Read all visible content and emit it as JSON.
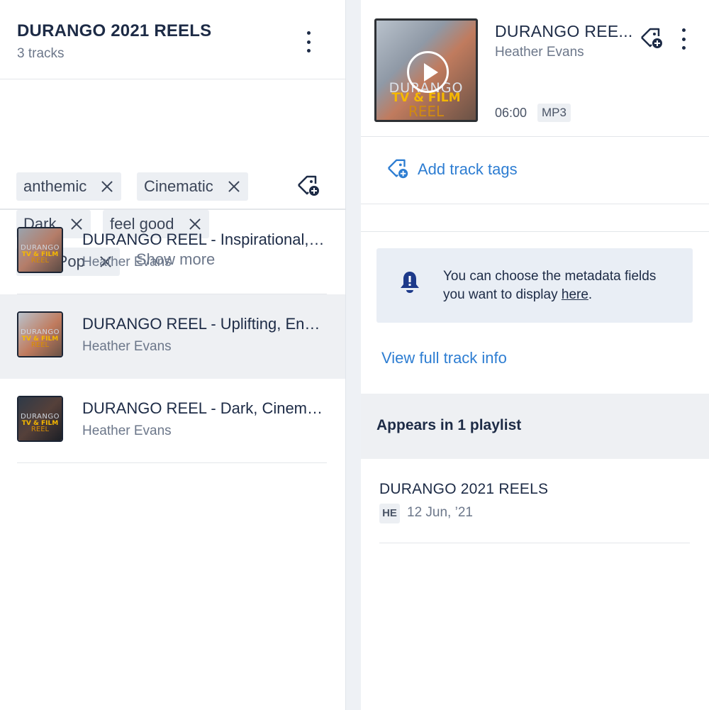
{
  "playlist": {
    "title": "DURANGO 2021 REELS",
    "track_count": "3 tracks",
    "tags": [
      "anthemic",
      "Cinematic",
      "Dark",
      "feel good",
      "Folk/Pop"
    ],
    "show_more": "Show more",
    "tracks": [
      {
        "title": "DURANGO REEL - Inspirational, Anthemic",
        "artist": "Heather Evans",
        "selected": false
      },
      {
        "title": "DURANGO REEL - Uplifting, Energetic",
        "artist": "Heather Evans",
        "selected": true
      },
      {
        "title": "DURANGO REEL - Dark, Cinematic",
        "artist": "Heather Evans",
        "selected": false
      }
    ],
    "thumb_text": {
      "line1": "DURANGO",
      "line2": "TV & FILM",
      "line3": "REEL"
    }
  },
  "detail": {
    "title": "DURANGO REE...",
    "artist": "Heather Evans",
    "duration": "06:00",
    "format": "MP3",
    "add_tags": "Add track tags",
    "notice_text": "You can choose the metadata fields you want to display ",
    "notice_link": "here",
    "notice_end": ".",
    "view_full": "View full track info",
    "appears_in": "Appears in 1 playlist",
    "playlist_title": "DURANGO 2021 REELS",
    "playlist_owner": "HE",
    "playlist_date": "12 Jun, ’21"
  },
  "colors": {
    "accent_blue": "#2d7dd2",
    "text_dark": "#1d2b46",
    "text_muted": "#6c778a",
    "tag_bg": "#eceff3",
    "selected_bg": "#eef0f3",
    "notice_bg": "#e9eef5"
  },
  "icons": [
    "more-vertical-icon",
    "close-icon",
    "tag-add-icon",
    "play-icon",
    "bell-icon"
  ]
}
